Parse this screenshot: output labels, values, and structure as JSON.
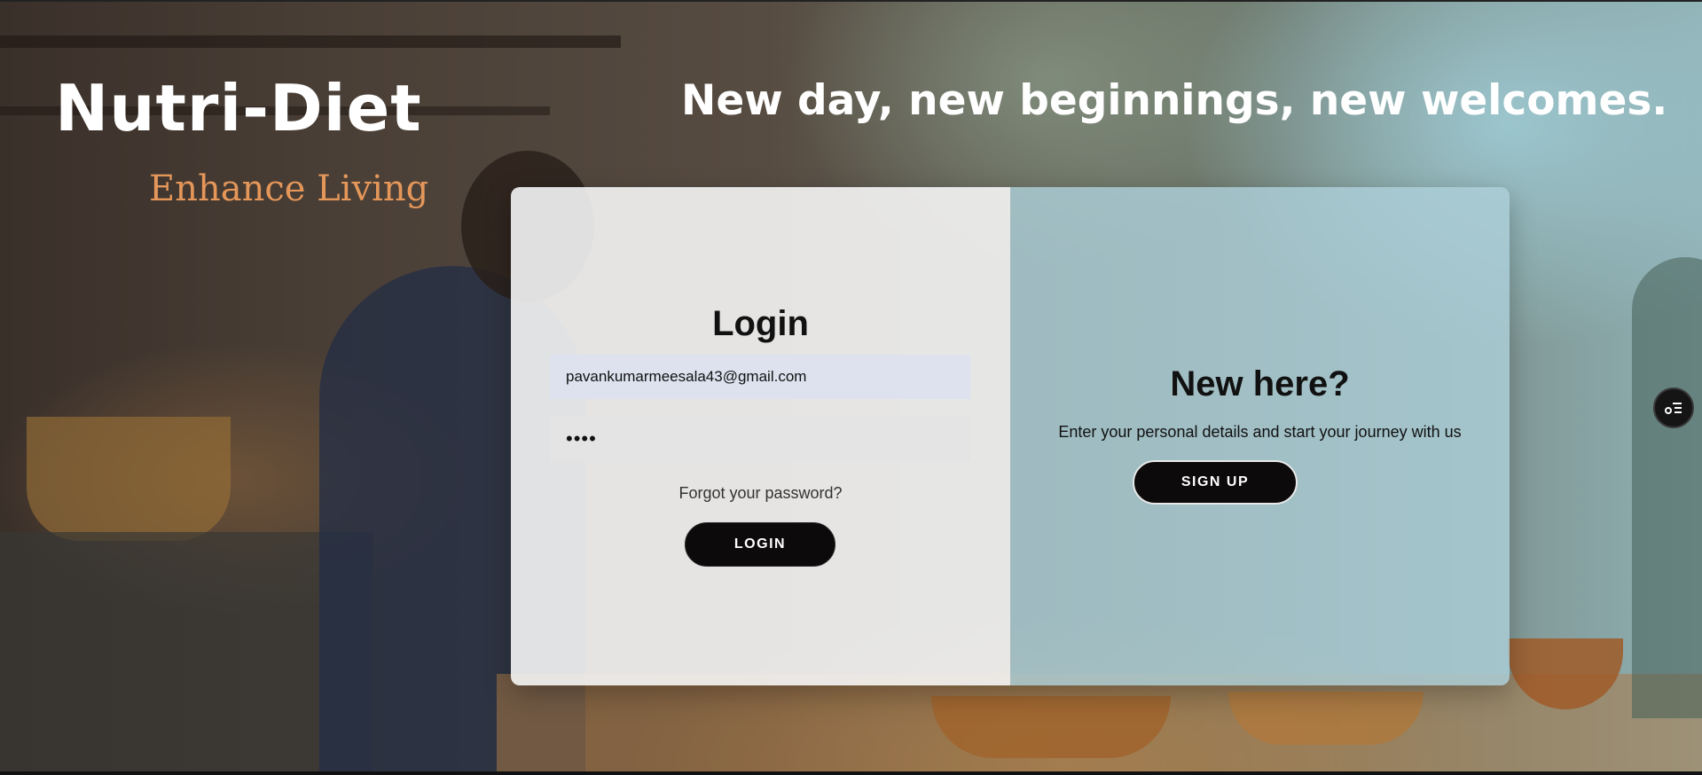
{
  "brand": {
    "name": "Nutri-Diet",
    "tagline": "Enhance Living"
  },
  "headline": "New day, new beginnings, new welcomes.",
  "login": {
    "title": "Login",
    "email_value": "pavankumarmeesala43@gmail.com",
    "password_value": "••••",
    "forgot_label": "Forgot your password?",
    "submit_label": "LOGIN"
  },
  "signup": {
    "title": "New here?",
    "text": "Enter your personal details and start your journey with us",
    "button_label": "SIGN UP"
  },
  "floating_action": {
    "icon": "list-settings-icon"
  },
  "colors": {
    "accent_tagline": "#e5975a",
    "button_bg": "#0c0a0a",
    "left_panel": "#f5f5f5",
    "right_panel": "#acced8"
  }
}
